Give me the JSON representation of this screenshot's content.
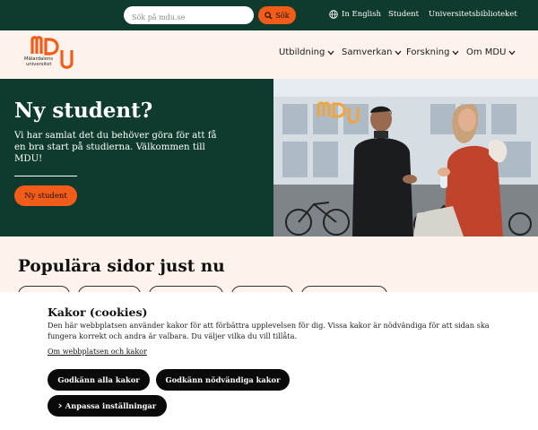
{
  "topbar": {
    "search_placeholder": "Sök på mdu.se",
    "search_button": "Sök",
    "english_link": "In English",
    "student_link": "Student",
    "library_link": "Universitetsbiblioteket"
  },
  "header": {
    "logo_text_line1": "Mälardalens",
    "logo_text_line2": "universitet",
    "nav": [
      "Utbildning",
      "Samverkan",
      "Forskning",
      "Om MDU"
    ]
  },
  "hero": {
    "title": "Ny student?",
    "text": "Vi har samlat det du behöver göra för att få en bra start på studierna. Välkommen till MDU!",
    "button": "Ny student"
  },
  "popular": {
    "title": "Populära sidor just nu"
  },
  "cookie": {
    "title": "Kakor (cookies)",
    "text": "Den här webbplatsen använder kakor för att förbättra upplevelsen för dig. Vissa kakor är nödvändiga för att sidan ska fungera korrekt och andra är valbara. Du väljer vilka du vill tillåta.",
    "link": "Om webbplatsen och kakor",
    "accept_all": "Godkänn alla kakor",
    "accept_necessary": "Godkänn nödvändiga kakor",
    "customize": "Anpassa inställningar"
  },
  "colors": {
    "brand_green": "#0e3b2d",
    "brand_orange": "#f25c19",
    "cream": "#fdf3ec"
  }
}
